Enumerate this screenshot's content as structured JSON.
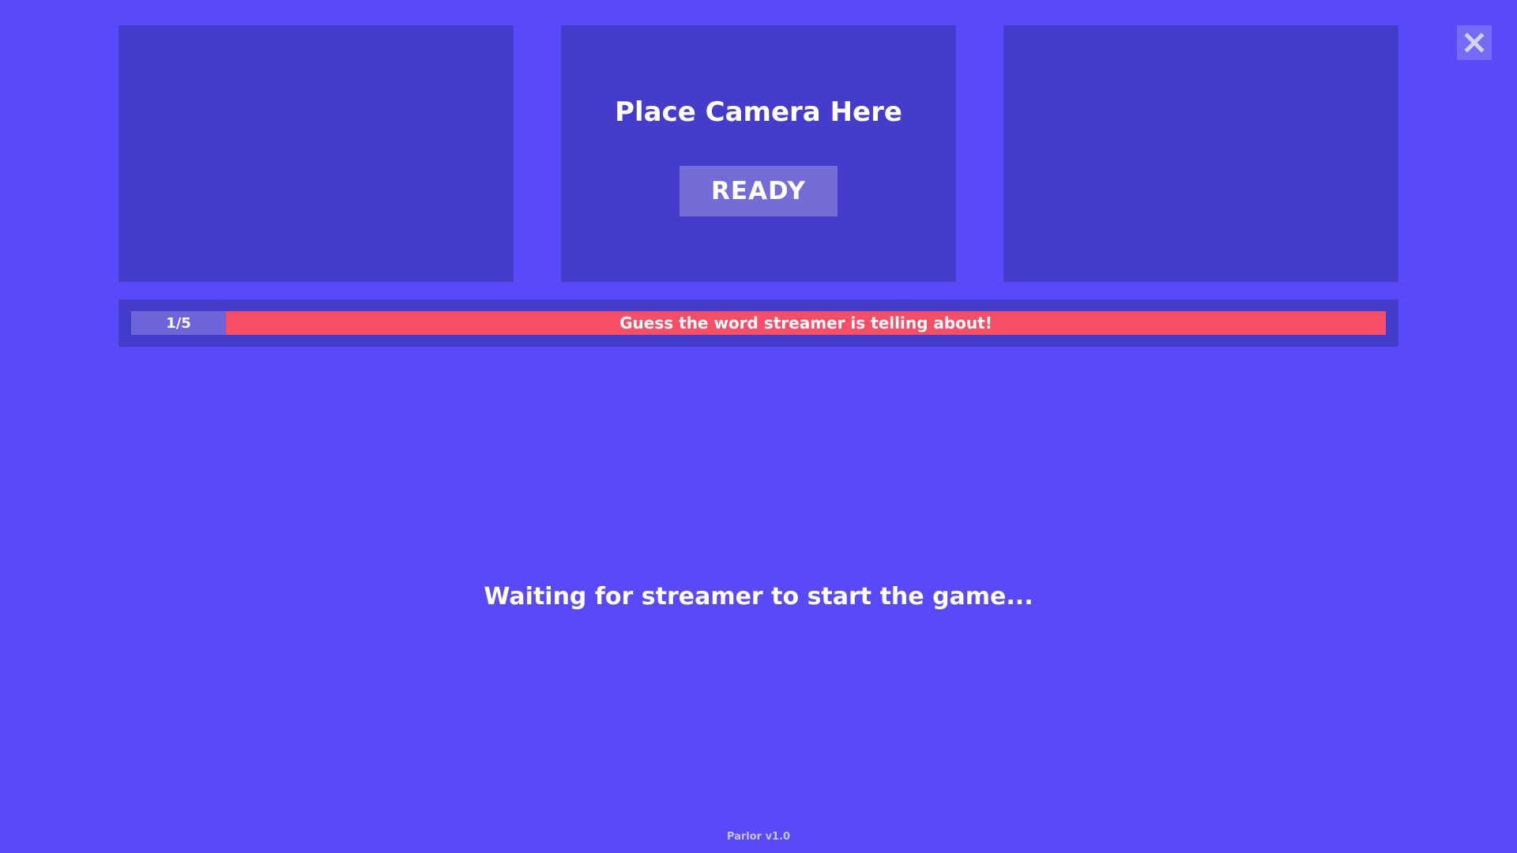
{
  "camera_panel": {
    "title": "Place Camera Here",
    "ready_label": "READY"
  },
  "close_icon": "close-icon",
  "status_bar": {
    "round": "1/5",
    "prompt": "Guess the word streamer is telling about!"
  },
  "waiting_message": "Waiting for streamer to start the game...",
  "version": "Parlor v1.0",
  "colors": {
    "background": "#584af8",
    "panel": "#443dcc",
    "button": "#746dd8",
    "banner": "#f74e68",
    "counter": "#6f65da"
  }
}
